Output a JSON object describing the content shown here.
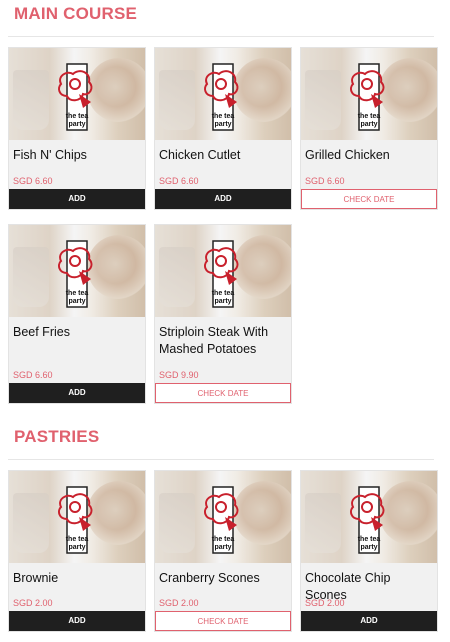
{
  "sections": [
    {
      "title": "MAIN COURSE",
      "items": [
        {
          "name": "Fish N' Chips",
          "price": "SGD 6.60",
          "button": "ADD"
        },
        {
          "name": "Chicken Cutlet",
          "price": "SGD 6.60",
          "button": "ADD"
        },
        {
          "name": "Grilled Chicken",
          "price": "SGD 6.60",
          "button": "CHECK DATE"
        },
        {
          "name": "Beef Fries",
          "price": "SGD 6.60",
          "button": "ADD"
        },
        {
          "name": "Striploin Steak With Mashed Potatoes",
          "price": "SGD 9.90",
          "button": "CHECK DATE"
        }
      ]
    },
    {
      "title": "PASTRIES",
      "items": [
        {
          "name": "Brownie",
          "price": "SGD 2.00",
          "button": "ADD"
        },
        {
          "name": "Cranberry Scones",
          "price": "SGD 2.00",
          "button": "CHECK DATE"
        },
        {
          "name": "Chocolate Chip Scones",
          "price": "SGD 2.00",
          "button": "ADD"
        }
      ]
    }
  ],
  "brand": {
    "logo_text_line1": "the tea",
    "logo_text_line2": "party"
  },
  "colors": {
    "accent": "#e0616e",
    "add_button": "#1f1f1f",
    "card_bg": "#f1f1f1"
  },
  "icons": {
    "product_thumbnail": "tea-party-logo-icon"
  }
}
